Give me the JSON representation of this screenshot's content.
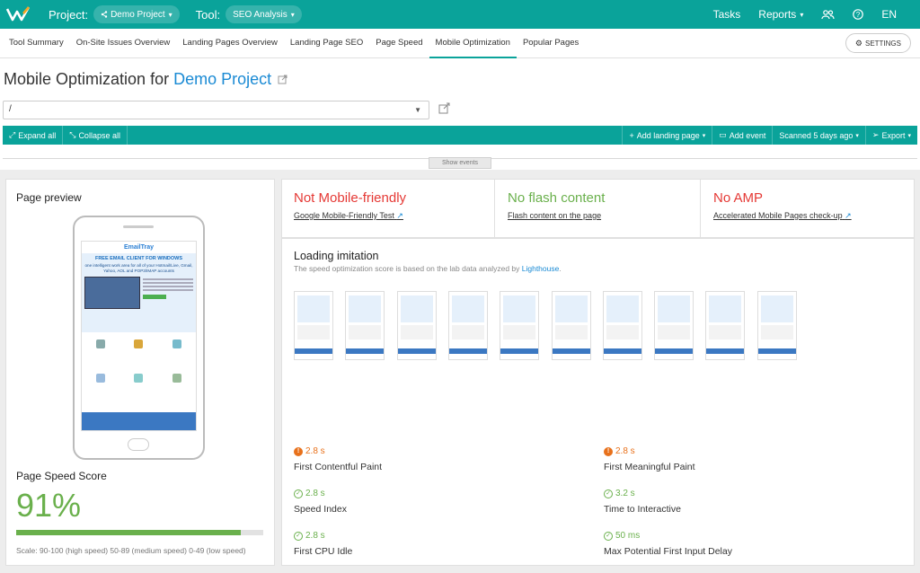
{
  "topbar": {
    "project_label": "Project:",
    "project_value": "Demo Project",
    "tool_label": "Tool:",
    "tool_value": "SEO Analysis",
    "tasks": "Tasks",
    "reports": "Reports",
    "lang": "EN"
  },
  "tabs": [
    {
      "label": "Tool Summary"
    },
    {
      "label": "On-Site Issues Overview"
    },
    {
      "label": "Landing Pages Overview"
    },
    {
      "label": "Landing Page SEO"
    },
    {
      "label": "Page Speed"
    },
    {
      "label": "Mobile Optimization"
    },
    {
      "label": "Popular Pages"
    }
  ],
  "settings_label": "SETTINGS",
  "page": {
    "title_prefix": "Mobile Optimization for ",
    "project_name": "Demo Project",
    "url_value": "/"
  },
  "toolbar": {
    "expand_all": "Expand all",
    "collapse_all": "Collapse all",
    "add_landing_page": "Add landing page",
    "add_event": "Add event",
    "scanned": "Scanned 5 days ago",
    "export": "Export"
  },
  "show_events": "Show events",
  "preview": {
    "title": "Page preview",
    "speed_title": "Page Speed Score",
    "score": "91%",
    "score_value": 0.91,
    "scale": "Scale: 90-100 (high speed) 50-89 (medium speed) 0-49 (low speed)",
    "site_brand": "EmailTray",
    "site_headline": "FREE EMAIL CLIENT FOR WINDOWS",
    "site_sub": "one intelligent work area for all of your Hotmail/Live, Gmail, Yahoo, AOL and POP3/IMAP accounts"
  },
  "status": [
    {
      "title": "Not Mobile-friendly",
      "link": "Google Mobile-Friendly Test",
      "color": "#e53935"
    },
    {
      "title": "No flash content",
      "link": "Flash content on the page",
      "color": "#6ab04c"
    },
    {
      "title": "No AMP",
      "link": "Accelerated Mobile Pages check-up",
      "color": "#e53935"
    }
  ],
  "loading": {
    "title": "Loading imitation",
    "desc_prefix": "The speed optimization score is based on the lab data analyzed by ",
    "desc_link": "Lighthouse",
    "desc_suffix": "."
  },
  "metrics": [
    {
      "value": "2.8 s",
      "name": "First Contentful Paint",
      "status": "warning",
      "color": "#e8711b"
    },
    {
      "value": "2.8 s",
      "name": "First Meaningful Paint",
      "status": "warning",
      "color": "#e8711b"
    },
    {
      "value": "2.8 s",
      "name": "Speed Index",
      "status": "ok",
      "color": "#6ab04c"
    },
    {
      "value": "3.2 s",
      "name": "Time to Interactive",
      "status": "ok",
      "color": "#6ab04c"
    },
    {
      "value": "2.8 s",
      "name": "First CPU Idle",
      "status": "ok",
      "color": "#6ab04c"
    },
    {
      "value": "50 ms",
      "name": "Max Potential First Input Delay",
      "status": "ok",
      "color": "#6ab04c"
    }
  ]
}
